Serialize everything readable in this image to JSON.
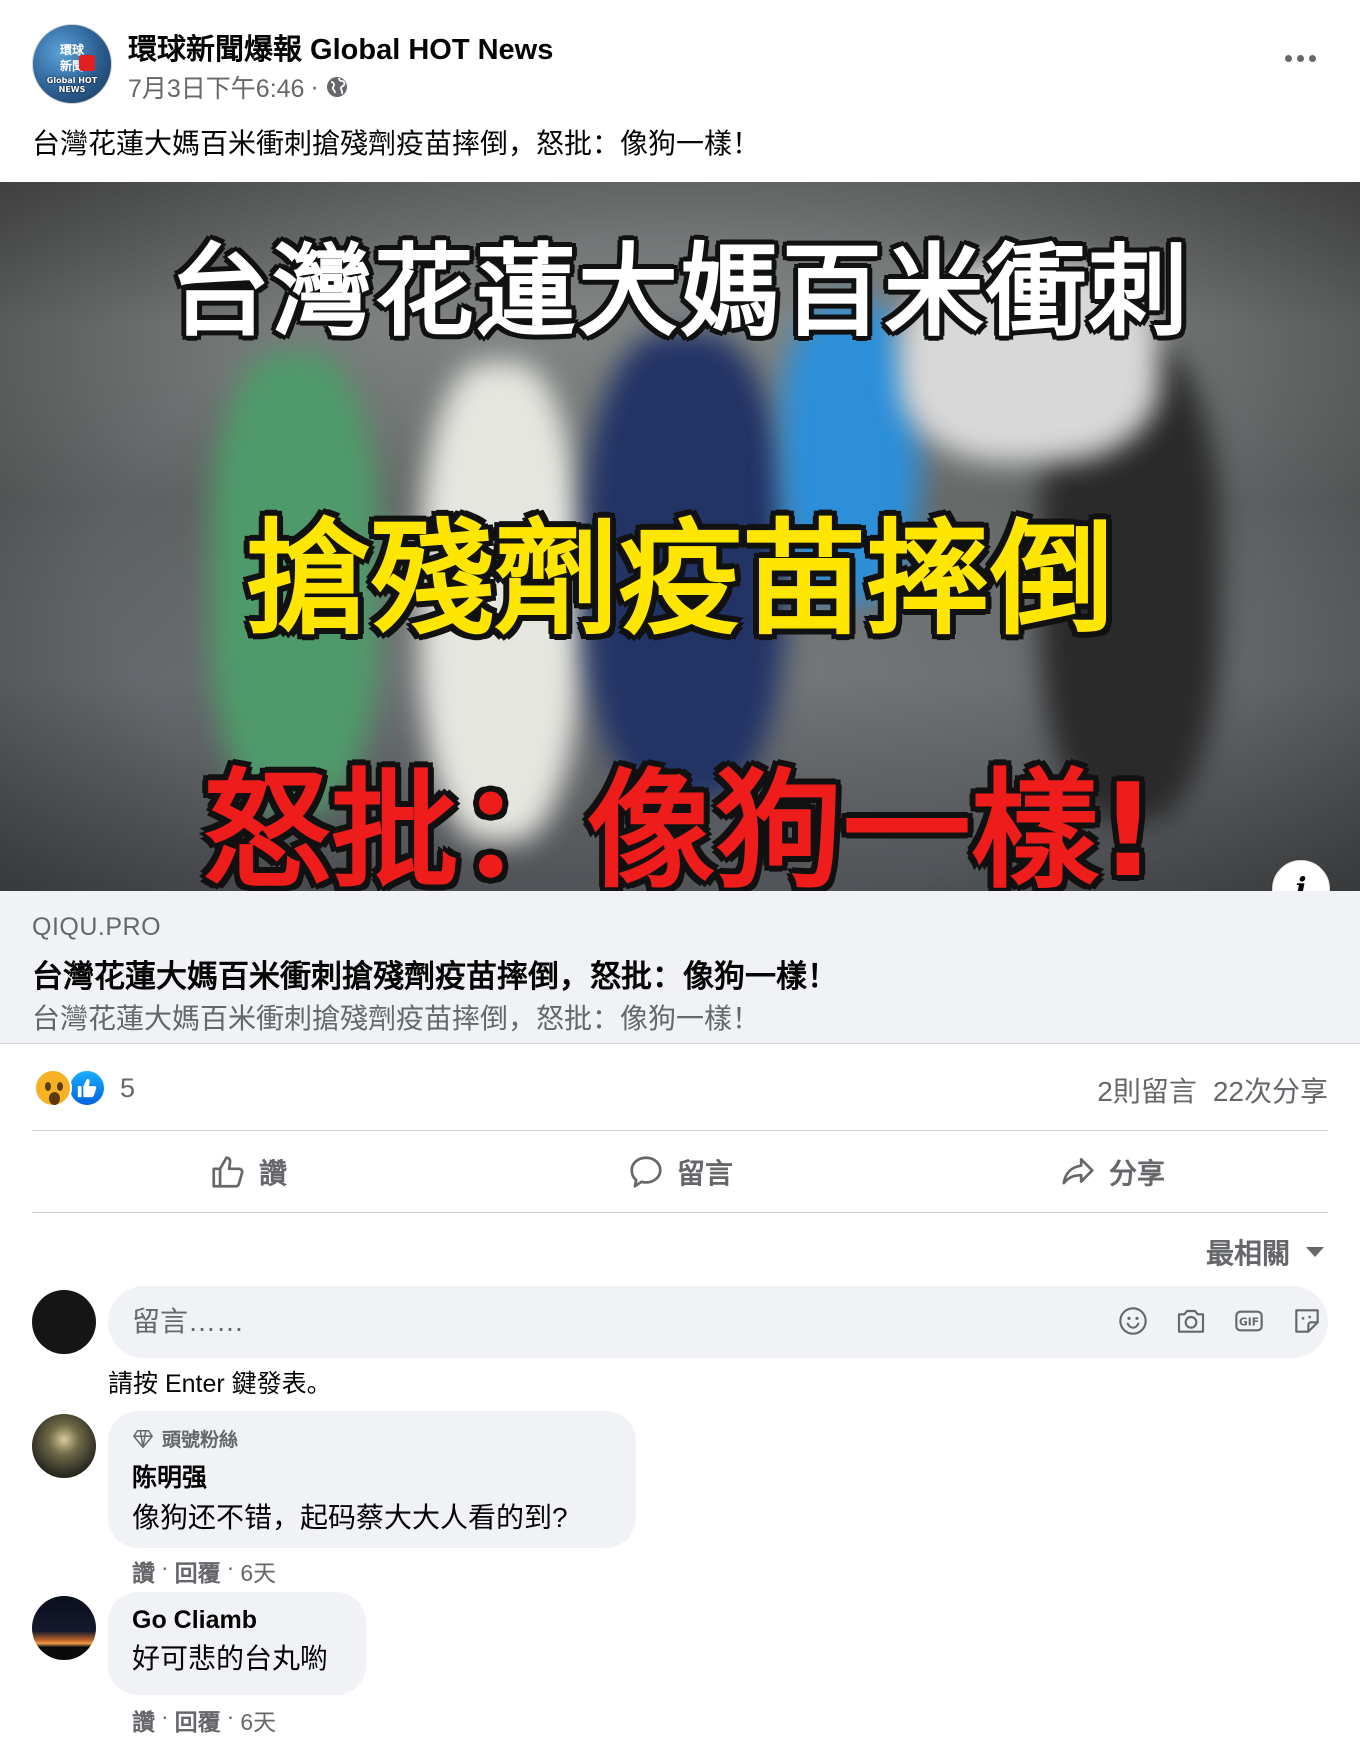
{
  "post": {
    "page_name": "環球新聞爆報 Global HOT News",
    "avatar_text": {
      "line1": "環球",
      "line2": "新聞",
      "line3": "Global HOT NEWS"
    },
    "timestamp": "7月3日下午6:46",
    "meta_separator": "·",
    "privacy_icon": "globe-icon",
    "text": "台灣花蓮大媽百米衝刺搶殘劑疫苗摔倒，怒批：像狗一樣！"
  },
  "image": {
    "headline_1": "台灣花蓮大媽百米衝刺",
    "headline_2": "搶殘劑疫苗摔倒",
    "headline_3": "怒批：像狗一樣!",
    "info_label": "i"
  },
  "link_preview": {
    "domain": "QIQU.PRO",
    "title": "台灣花蓮大媽百米衝刺搶殘劑疫苗摔倒，怒批：像狗一樣！",
    "description": "台灣花蓮大媽百米衝刺搶殘劑疫苗摔倒，怒批：像狗一樣！"
  },
  "engagement": {
    "reaction_icons": [
      "wow-icon",
      "like-icon"
    ],
    "reaction_count": "5",
    "comments_count": "2則留言",
    "shares_count": "22次分享"
  },
  "actions": {
    "like": "讚",
    "comment": "留言",
    "share": "分享"
  },
  "comments_section": {
    "sort_label": "最相關",
    "composer_placeholder": "留言……",
    "enter_hint": "請按 Enter 鍵發表。",
    "composer_icons": [
      "emoji-icon",
      "camera-icon",
      "gif-icon",
      "sticker-icon"
    ]
  },
  "comments": [
    {
      "badge": "頭號粉絲",
      "author": "陈明强",
      "text": "像狗还不错，起码蔡大大人看的到?",
      "like_label": "讚",
      "reply_label": "回覆",
      "time": "6天"
    },
    {
      "author": "Go Cliamb",
      "text": "好可悲的台丸喲",
      "like_label": "讚",
      "reply_label": "回覆",
      "time": "6天"
    }
  ],
  "colors": {
    "text_primary": "#050505",
    "text_secondary": "#65676b",
    "bubble_bg": "#f0f2f5",
    "divider": "#ced0d4",
    "headline_white": "#ffffff",
    "headline_yellow": "#ffe600",
    "headline_red": "#ef1c1c",
    "like_blue": "#0062df"
  }
}
